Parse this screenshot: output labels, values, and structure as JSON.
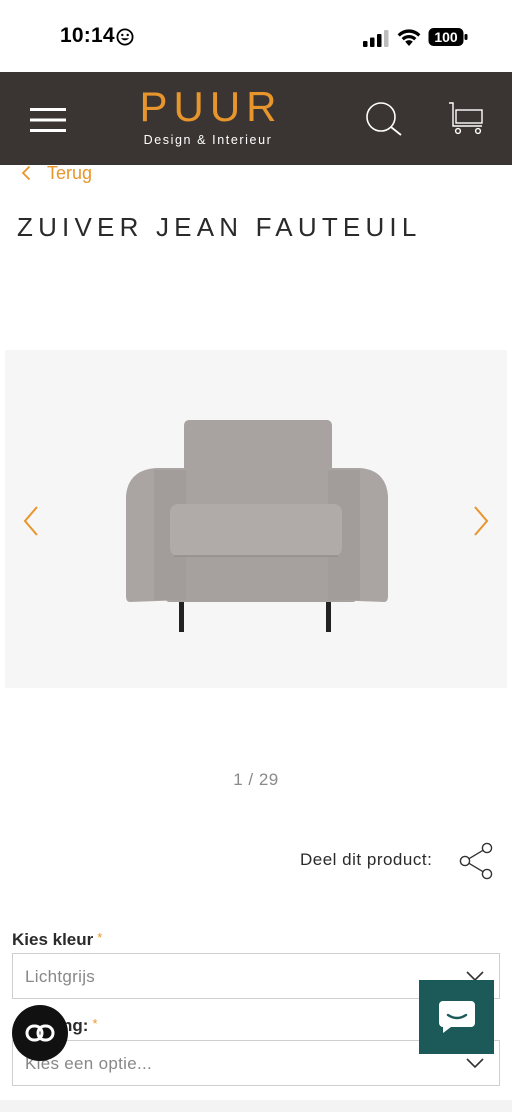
{
  "status_bar": {
    "time": "10:14",
    "battery": "100"
  },
  "header": {
    "logo": "PUUR",
    "tagline": "Design & Interieur",
    "icons": [
      "menu-icon",
      "search-icon",
      "cart-icon"
    ]
  },
  "nav": {
    "back_label": "Terug"
  },
  "product": {
    "title": "ZUIVER JEAN FAUTEUIL",
    "image_alt_icon": "armchair",
    "gallery_counter": "1 / 29",
    "share_label": "Deel dit product:"
  },
  "form": {
    "color_label": "Kies kleur",
    "color_required": "*",
    "color_value": "Lichtgrijs",
    "second_label": "ng:",
    "second_required": "*",
    "second_placeholder": "Kies een optie..."
  },
  "colors": {
    "header_bg": "#3a3532",
    "accent": "#e8952b",
    "chat_bg": "#1c5a5a"
  }
}
